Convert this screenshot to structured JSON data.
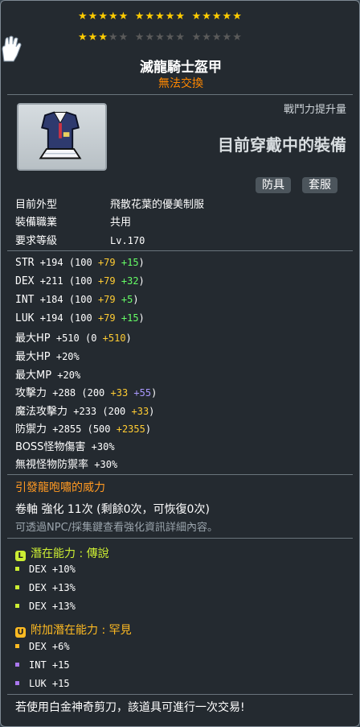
{
  "stars": {
    "filled": 18,
    "total": 25
  },
  "item": {
    "name": "滅龍騎士盔甲",
    "trade": "無法交換"
  },
  "combat_power_label": "戰鬥力提升量",
  "equipped_label": "目前穿戴中的裝備",
  "tags": [
    "防具",
    "套服"
  ],
  "info": [
    {
      "label": "目前外型",
      "value": "飛散花葉的優美制服"
    },
    {
      "label": "裝備職業",
      "value": "共用"
    },
    {
      "label": "要求等級",
      "value": "Lv.170"
    }
  ],
  "stats": [
    {
      "name": "STR",
      "total": "+194",
      "base": "(100",
      "bonus": [
        {
          "v": "+79",
          "c": "y"
        },
        {
          "v": "+15",
          "c": "g"
        }
      ],
      "close": ")"
    },
    {
      "name": "DEX",
      "total": "+211",
      "base": "(100",
      "bonus": [
        {
          "v": "+79",
          "c": "y"
        },
        {
          "v": "+32",
          "c": "g"
        }
      ],
      "close": ")"
    },
    {
      "name": "INT",
      "total": "+184",
      "base": "(100",
      "bonus": [
        {
          "v": "+79",
          "c": "y"
        },
        {
          "v": "+5",
          "c": "g"
        }
      ],
      "close": ")"
    },
    {
      "name": "LUK",
      "total": "+194",
      "base": "(100",
      "bonus": [
        {
          "v": "+79",
          "c": "y"
        },
        {
          "v": "+15",
          "c": "g"
        }
      ],
      "close": ")"
    },
    {
      "name": "最大HP",
      "total": "+510",
      "base": "(0",
      "bonus": [
        {
          "v": "+510",
          "c": "y"
        }
      ],
      "close": ")"
    },
    {
      "name": "最大HP",
      "total": "+20%",
      "base": "",
      "bonus": [],
      "close": ""
    },
    {
      "name": "最大MP",
      "total": "+20%",
      "base": "",
      "bonus": [],
      "close": ""
    },
    {
      "name": "攻擊力",
      "total": "+288",
      "base": "(200",
      "bonus": [
        {
          "v": "+33",
          "c": "y"
        },
        {
          "v": "+55",
          "c": "p"
        }
      ],
      "close": ")"
    },
    {
      "name": "魔法攻擊力",
      "total": "+233",
      "base": "(200",
      "bonus": [
        {
          "v": "+33",
          "c": "y"
        }
      ],
      "close": ")"
    },
    {
      "name": "防禦力",
      "total": "+2855",
      "base": "(500",
      "bonus": [
        {
          "v": "+2355",
          "c": "y"
        }
      ],
      "close": ")"
    },
    {
      "name": "BOSS怪物傷害",
      "total": "+30%",
      "base": "",
      "bonus": [],
      "close": ""
    },
    {
      "name": "無視怪物防禦率",
      "total": "+30%",
      "base": "",
      "bonus": [],
      "close": ""
    }
  ],
  "set_name": "引發龍咆嘯的威力",
  "scroll": {
    "line": "卷軸 強化 11次 (剩餘0次，可恢復0次)",
    "hint": "可透過NPC/採集鍵查看強化資訊詳細內容。"
  },
  "potential": {
    "badge": "L",
    "title": "潛在能力 : 傳說",
    "color": "#ccee33",
    "lines": [
      "DEX +10%",
      "DEX +13%",
      "DEX +13%"
    ]
  },
  "additional": {
    "badge": "U",
    "title": "附加潛在能力 : 罕見",
    "color": "#ffbb22",
    "lines": [
      {
        "text": "DEX +6%",
        "color": "#ffbb22"
      },
      {
        "text": "INT +15",
        "color": "#aa77ee"
      },
      {
        "text": "LUK +15",
        "color": "#aa77ee"
      }
    ]
  },
  "footer": "若使用白金神奇剪刀，該道具可進行一次交易!",
  "colors": {
    "yellow": "#ffcc33",
    "green": "#66ff66",
    "purple": "#aa99ff",
    "orange": "#ff8800",
    "set_orange": "#ff9922"
  }
}
